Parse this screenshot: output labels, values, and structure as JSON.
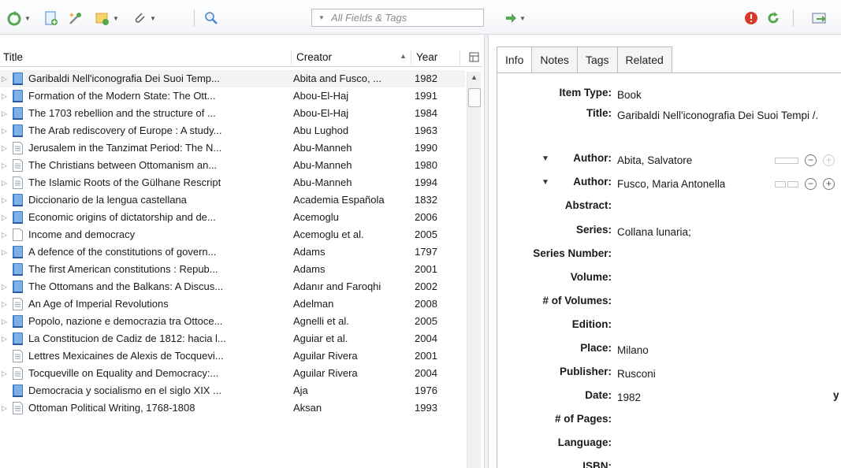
{
  "search": {
    "placeholder": "All Fields & Tags"
  },
  "colors": {
    "accent_blue": "#4a86c8",
    "book_blue": "#3d7cc9",
    "orange": "#f2a33a",
    "green": "#55a84d",
    "red": "#d83a2a"
  },
  "columns": {
    "title": "Title",
    "creator": "Creator",
    "year": "Year"
  },
  "items": [
    {
      "title": "Garibaldi Nell'iconografia Dei Suoi Temp...",
      "creator": "Abita and Fusco, ...",
      "year": "1982",
      "icon": "book-icon",
      "twisty": true,
      "selected": true
    },
    {
      "title": "Formation of the Modern State: The Ott...",
      "creator": "Abou-El-Haj",
      "year": "1991",
      "icon": "book-icon",
      "twisty": true
    },
    {
      "title": "The 1703 rebellion and the structure of ...",
      "creator": "Abou-El-Haj",
      "year": "1984",
      "icon": "book-icon",
      "twisty": true
    },
    {
      "title": "The Arab rediscovery of Europe : A study...",
      "creator": "Abu Lughod",
      "year": "1963",
      "icon": "book-icon",
      "twisty": true
    },
    {
      "title": "Jerusalem in the Tanzimat Period: The N...",
      "creator": "Abu-Manneh",
      "year": "1990",
      "icon": "journal-article-icon",
      "twisty": true
    },
    {
      "title": "The Christians between Ottomanism an...",
      "creator": "Abu-Manneh",
      "year": "1980",
      "icon": "journal-article-icon",
      "twisty": true
    },
    {
      "title": "The Islamic Roots of the Gülhane Rescript",
      "creator": "Abu-Manneh",
      "year": "1994",
      "icon": "journal-article-icon",
      "twisty": true
    },
    {
      "title": "Diccionario de la lengua castellana",
      "creator": "Academia Española",
      "year": "1832",
      "icon": "book-icon",
      "twisty": true
    },
    {
      "title": "Economic origins of dictatorship and de...",
      "creator": "Acemoglu",
      "year": "2006",
      "icon": "book-icon",
      "twisty": true
    },
    {
      "title": "Income and democracy",
      "creator": "Acemoglu et al.",
      "year": "2005",
      "icon": "document-icon",
      "twisty": true
    },
    {
      "title": "A defence of the constitutions of govern...",
      "creator": "Adams",
      "year": "1797",
      "icon": "book-icon",
      "twisty": true
    },
    {
      "title": "The first American constitutions : Repub...",
      "creator": "Adams",
      "year": "2001",
      "icon": "book-icon",
      "twisty": false
    },
    {
      "title": "The Ottomans and the Balkans: A Discus...",
      "creator": "Adanır and Faroqhi",
      "year": "2002",
      "icon": "book-icon",
      "twisty": true
    },
    {
      "title": "An Age of Imperial Revolutions",
      "creator": "Adelman",
      "year": "2008",
      "icon": "journal-article-icon",
      "twisty": true
    },
    {
      "title": "Popolo, nazione e democrazia tra Ottoce...",
      "creator": "Agnelli et al.",
      "year": "2005",
      "icon": "book-icon",
      "twisty": true
    },
    {
      "title": "La Constitucion de Cadiz de 1812: hacia l...",
      "creator": "Aguiar et al.",
      "year": "2004",
      "icon": "book-icon",
      "twisty": true
    },
    {
      "title": "Lettres Mexicaines de Alexis de Tocquevi...",
      "creator": "Aguilar Rivera",
      "year": "2001",
      "icon": "journal-article-icon",
      "twisty": false
    },
    {
      "title": "Tocqueville on Equality and Democracy:...",
      "creator": "Aguilar Rivera",
      "year": "2004",
      "icon": "journal-article-icon",
      "twisty": true
    },
    {
      "title": "Democracia y socialismo en el siglo XIX ...",
      "creator": "Aja",
      "year": "1976",
      "icon": "book-icon",
      "twisty": false
    },
    {
      "title": "Ottoman Political Writing, 1768-1808",
      "creator": "Aksan",
      "year": "1993",
      "icon": "journal-article-icon",
      "twisty": true
    }
  ],
  "tabs": [
    "Info",
    "Notes",
    "Tags",
    "Related"
  ],
  "info": {
    "item_type_label": "Item Type:",
    "item_type": "Book",
    "title_label": "Title:",
    "title": "Garibaldi Nell'iconografia Dei Suoi Tempi /.",
    "author_label": "Author:",
    "author1": "Abita, Salvatore",
    "author2": "Fusco, Maria Antonella",
    "abstract_label": "Abstract:",
    "series_label": "Series:",
    "series": "Collana lunaria;",
    "series_number_label": "Series Number:",
    "volume_label": "Volume:",
    "num_volumes_label": "# of Volumes:",
    "edition_label": "Edition:",
    "place_label": "Place:",
    "place": "Milano",
    "publisher_label": "Publisher:",
    "publisher": "Rusconi",
    "date_label": "Date:",
    "date": "1982",
    "date_suffix": "y",
    "num_pages_label": "# of Pages:",
    "language_label": "Language:",
    "isbn_label": "ISBN:"
  }
}
